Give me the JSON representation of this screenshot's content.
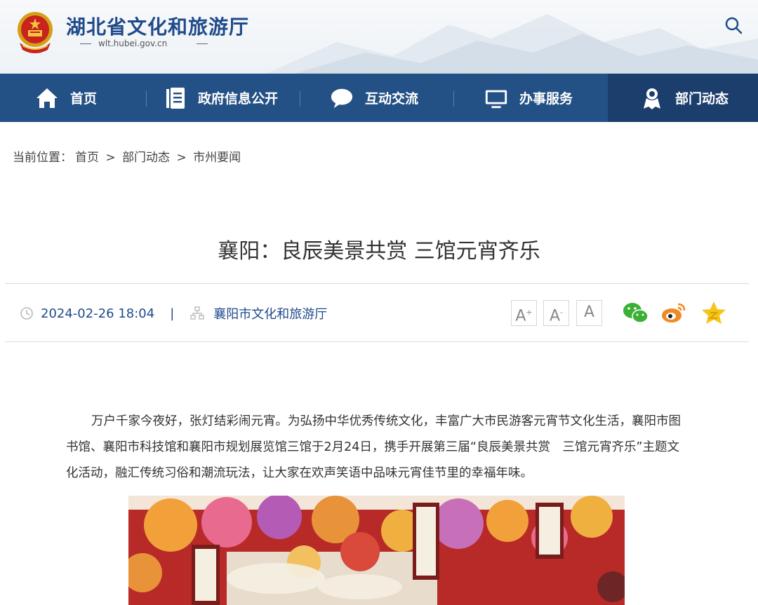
{
  "header": {
    "site_title": "湖北省文化和旅游厅",
    "domain": "wlt.hubei.gov.cn",
    "search_icon": "search-icon"
  },
  "nav": {
    "items": [
      {
        "label": "首页",
        "icon": "home-icon"
      },
      {
        "label": "政府信息公开",
        "icon": "document-list-icon"
      },
      {
        "label": "互动交流",
        "icon": "chat-bubble-icon"
      },
      {
        "label": "办事服务",
        "icon": "monitor-icon"
      },
      {
        "label": "部门动态",
        "icon": "award-person-icon",
        "active": true
      }
    ],
    "active_color": "#1c3e6c",
    "bar_color": "#245185"
  },
  "breadcrumb": {
    "prefix": "当前位置：",
    "items": [
      "首页",
      "部门动态",
      "市州要闻"
    ],
    "separator": ">"
  },
  "article": {
    "title": "襄阳：良辰美景共赏 三馆元宵齐乐",
    "date": "2024-02-26 18:04",
    "divider": "|",
    "source": "襄阳市文化和旅游厅",
    "paragraph": "万户千家今夜好，张灯结彩闹元宵。为弘扬中华优秀传统文化，丰富广大市民游客元宵节文化生活，襄阳市图书馆、襄阳市科技馆和襄阳市规划展览馆三馆于2月24日，携手开展第三届“良辰美景共赏　三馆元宵齐乐”主题文化活动，融汇传统习俗和潮流玩法，让大家在欢声笑语中品味元宵佳节里的幸福年味。",
    "photo_alt": "三馆元宵齐乐 lantern festival photo"
  },
  "tools": {
    "font_larger": "A",
    "font_larger_sup": "+",
    "font_smaller": "A",
    "font_smaller_sup": "-",
    "font_default": "A",
    "share": [
      "wechat-icon",
      "weibo-icon",
      "favorite-star-icon"
    ]
  }
}
